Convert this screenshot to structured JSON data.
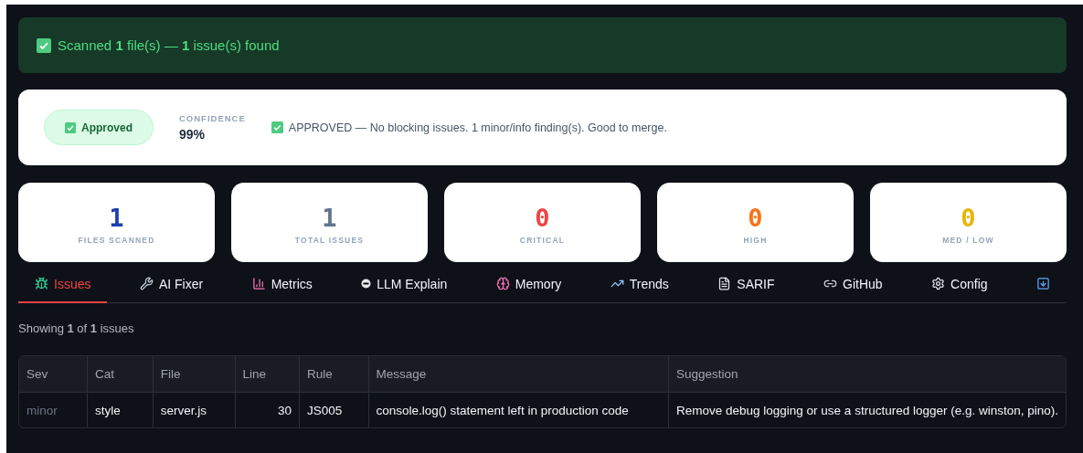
{
  "banner": {
    "text": "Scanned **1** file(s) — **1** issue(s) found"
  },
  "verdict": {
    "badge": "Approved",
    "confidence_label": "CONFIDENCE",
    "confidence": "99%",
    "message": "APPROVED — No blocking issues. 1 minor/info finding(s). Good to merge."
  },
  "stats": [
    {
      "value": "1",
      "label": "FILES SCANNED",
      "color": "#1e40af"
    },
    {
      "value": "1",
      "label": "TOTAL ISSUES",
      "color": "#64748b"
    },
    {
      "value": "0",
      "label": "CRITICAL",
      "color": "#ef4444"
    },
    {
      "value": "0",
      "label": "HIGH",
      "color": "#f97316"
    },
    {
      "value": "0",
      "label": "MED / LOW",
      "color": "#eab308"
    }
  ],
  "tabs": [
    {
      "label": "Issues",
      "selected": true
    },
    {
      "label": "AI Fixer",
      "selected": false
    },
    {
      "label": "Metrics",
      "selected": false
    },
    {
      "label": "LLM Explain",
      "selected": false
    },
    {
      "label": "Memory",
      "selected": false
    },
    {
      "label": "Trends",
      "selected": false
    },
    {
      "label": "SARIF",
      "selected": false
    },
    {
      "label": "GitHub",
      "selected": false
    },
    {
      "label": "Config",
      "selected": false
    },
    {
      "selected": false
    }
  ],
  "summary": "Showing **1** of **1** issues",
  "table": {
    "columns": [
      "Sev",
      "Cat",
      "File",
      "Line",
      "Rule",
      "Message",
      "Suggestion"
    ],
    "rows": [
      {
        "cells": [
          "minor",
          "style",
          "server.js",
          "30",
          "JS005",
          "console.log() statement left in production code",
          "Remove debug logging or use a structured logger (e.g. winston, pino)."
        ]
      }
    ]
  }
}
